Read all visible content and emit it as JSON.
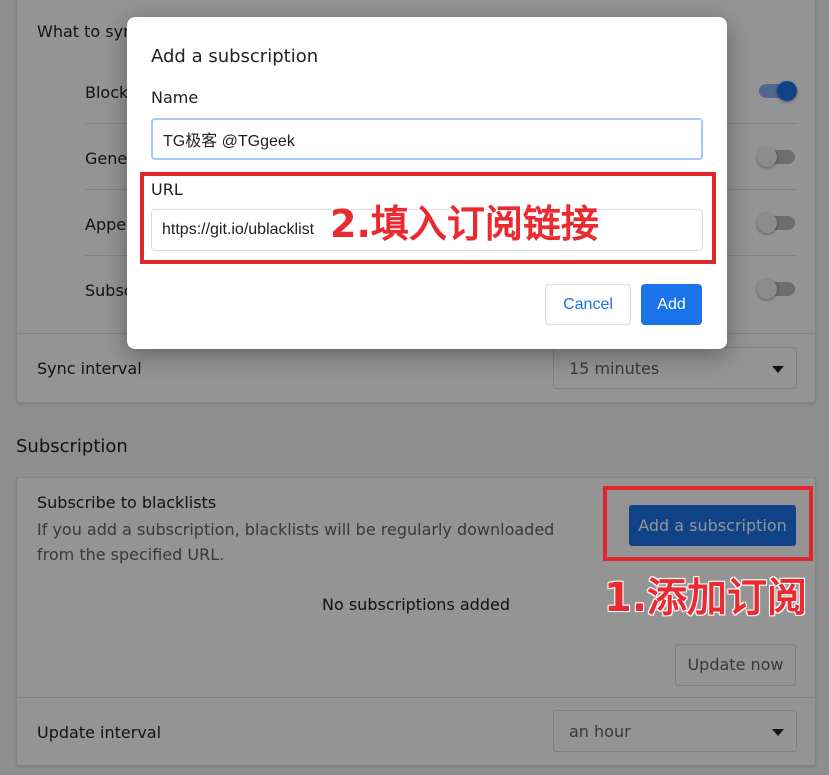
{
  "sync_section": {
    "what_to_sync_label": "What to sync",
    "items": [
      {
        "label": "Blocked sites",
        "enabled": true
      },
      {
        "label": "General",
        "enabled": false
      },
      {
        "label": "Appearance",
        "enabled": false
      },
      {
        "label": "Subscriptions",
        "enabled": false
      }
    ],
    "sync_interval_label": "Sync interval",
    "sync_interval_value": "15 minutes"
  },
  "subscription_section": {
    "title": "Subscription",
    "subscribe_heading": "Subscribe to blacklists",
    "subscribe_description": "If you add a subscription, blacklists will be regularly downloaded from the specified URL.",
    "add_button_label": "Add a subscription",
    "empty_state": "No subscriptions added",
    "update_now_label": "Update now",
    "update_interval_label": "Update interval",
    "update_interval_value": "an hour"
  },
  "dialog": {
    "title": "Add a subscription",
    "name_label": "Name",
    "name_value": "TG极客 @TGgeek",
    "url_label": "URL",
    "url_value": "https://git.io/ublacklist",
    "cancel_label": "Cancel",
    "add_label": "Add"
  },
  "annotations": {
    "step1": "1.添加订阅",
    "step2": "2.填入订阅链接",
    "color": "#e0252b"
  },
  "colors": {
    "accent": "#1a73e8",
    "overlay": "rgba(0,0,0,0.42)"
  }
}
